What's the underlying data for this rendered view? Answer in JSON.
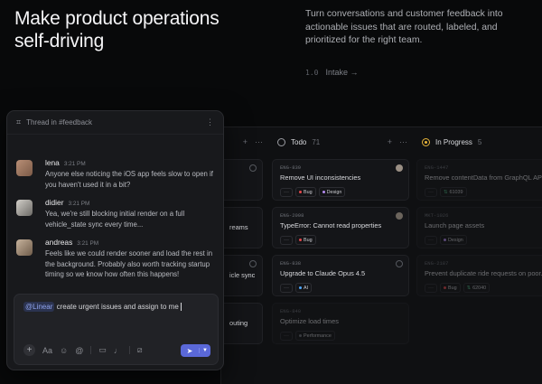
{
  "hero": {
    "title": "Make product operations self-driving",
    "subtitle": "Turn conversations and customer feedback into actionable issues that are routed, labeled, and prioritized for the right team.",
    "section_number": "1.0",
    "section_link": "Intake →"
  },
  "board": {
    "columns": [
      {
        "name": "",
        "count": ""
      },
      {
        "name": "Todo",
        "count": "71"
      },
      {
        "name": "In Progress",
        "count": "5"
      }
    ],
    "left_col_partial_titles": [
      "reams",
      "icle sync",
      "outing"
    ],
    "todo_cards": [
      {
        "id": "ENG-839",
        "title": "Remove UI inconsistencies",
        "tags": [
          "Bug",
          "Design"
        ]
      },
      {
        "id": "ENG-2098",
        "title": "TypeError: Cannot read properties",
        "tags": [
          "Bug"
        ]
      },
      {
        "id": "ENG-838",
        "title": "Upgrade to Claude Opus 4.5",
        "tags": [
          "AI"
        ]
      },
      {
        "id": "ENG-840",
        "title": "Optimize load times",
        "tags": [
          "Performance"
        ]
      }
    ],
    "progress_cards": [
      {
        "id": "ENG-1447",
        "title": "Remove contentData from GraphQL API",
        "tags": [
          "61039"
        ]
      },
      {
        "id": "MKT-1026",
        "title": "Launch page assets",
        "tags": [
          "Design"
        ]
      },
      {
        "id": "ENG-2187",
        "title": "Prevent duplicate ride requests on poor...",
        "tags": [
          "Bug",
          "62040"
        ]
      }
    ]
  },
  "thread": {
    "title": "Thread in #feedback",
    "messages": [
      {
        "name": "lena",
        "time": "3:21 PM",
        "text": "Anyone else noticing the iOS app feels slow to open if you haven't used it in a bit?"
      },
      {
        "name": "didier",
        "time": "3:21 PM",
        "text": "Yea, we're still blocking initial render on a full vehicle_state sync every time..."
      },
      {
        "name": "andreas",
        "time": "3:21 PM",
        "text": "Feels like we could render sooner and load the rest in the background. Probably also worth tracking startup timing so we know how often this happens!"
      }
    ],
    "composer": {
      "mention": "@Linear",
      "text": " create urgent issues and assign to me"
    }
  },
  "colors": {
    "accent": "#5a68d8",
    "in_progress": "#e8b53a",
    "bug": "#e5484d",
    "ai": "#4ea7fc",
    "design": "#b58cf0"
  },
  "icons": [
    "hash-thread-icon",
    "kebab-icon",
    "plus-icon",
    "text-format-icon",
    "emoji-icon",
    "mention-icon",
    "video-icon",
    "mic-icon",
    "slash-command-icon",
    "send-icon",
    "chevron-down-icon"
  ]
}
